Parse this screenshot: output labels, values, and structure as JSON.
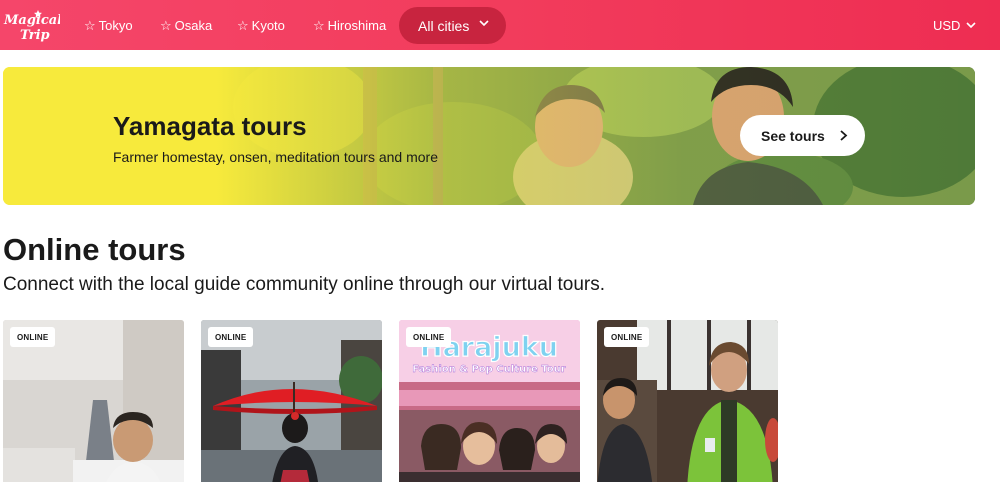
{
  "header": {
    "logo_text": "Magical Trip",
    "nav": [
      {
        "label": "Tokyo"
      },
      {
        "label": "Osaka"
      },
      {
        "label": "Kyoto"
      },
      {
        "label": "Hiroshima"
      }
    ],
    "all_cities_label": "All cities",
    "currency_label": "USD"
  },
  "banner": {
    "title": "Yamagata tours",
    "subtitle": "Farmer homestay, onsen, meditation tours and more",
    "cta_label": "See tours"
  },
  "online_section": {
    "title": "Online tours",
    "subtitle": "Connect with the local guide community online through our virtual tours."
  },
  "cards": [
    {
      "badge": "ONLINE",
      "image": "guide-video-call-photo"
    },
    {
      "badge": "ONLINE",
      "image": "geisha-red-umbrella-photo"
    },
    {
      "badge": "ONLINE",
      "image": "harajuku-fashion-pop-culture-photo",
      "overlay_title": "Harajuku",
      "overlay_subtitle": "Fashion & Pop Culture Tour"
    },
    {
      "badge": "ONLINE",
      "image": "guide-and-tourist-sake-photo"
    }
  ],
  "colors": {
    "brand": "#f23c5c",
    "all_cities_bg": "#c8243f",
    "banner_yellow": "#f7ea3c"
  }
}
